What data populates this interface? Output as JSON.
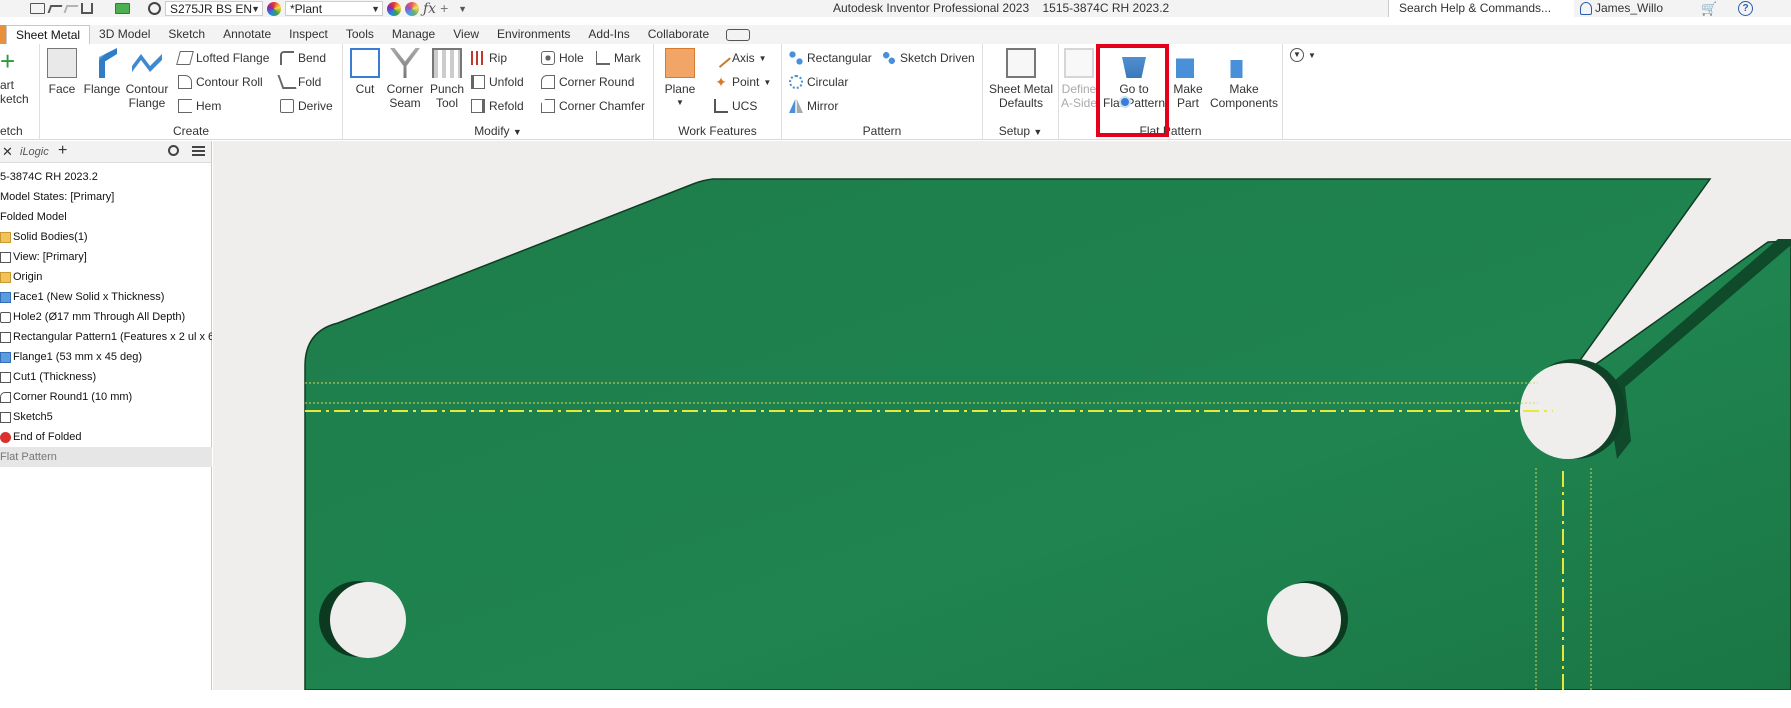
{
  "titlebar": {
    "material": "S275JR BS EN",
    "appearance": "*Plant",
    "app_name": "Autodesk Inventor Professional 2023",
    "doc_name": "1515-3874C RH 2023.2",
    "search_placeholder": "Search Help & Commands...",
    "user_name": "James_Willo"
  },
  "tabs": [
    {
      "label": "Sheet Metal",
      "active": true
    },
    {
      "label": "3D Model"
    },
    {
      "label": "Sketch"
    },
    {
      "label": "Annotate"
    },
    {
      "label": "Inspect"
    },
    {
      "label": "Tools"
    },
    {
      "label": "Manage"
    },
    {
      "label": "View"
    },
    {
      "label": "Environments"
    },
    {
      "label": "Add-Ins"
    },
    {
      "label": "Collaborate"
    }
  ],
  "ribbon": {
    "sketch": {
      "start": "art",
      "sketch": "ketch",
      "panel_title": "etch"
    },
    "create": {
      "panel_title": "Create",
      "face": "Face",
      "flange": "Flange",
      "contour_1": "Contour",
      "contour_2": "Flange",
      "lofted_flange": "Lofted Flange",
      "contour_roll": "Contour Roll",
      "hem": "Hem",
      "bend": "Bend",
      "fold": "Fold",
      "derive": "Derive"
    },
    "modify": {
      "panel_title": "Modify",
      "cut": "Cut",
      "corner_seam_1": "Corner",
      "corner_seam_2": "Seam",
      "punch_1": "Punch",
      "punch_2": "Tool",
      "rip": "Rip",
      "unfold": "Unfold",
      "refold": "Refold",
      "hole": "Hole",
      "corner_round": "Corner Round",
      "corner_chamfer": "Corner Chamfer",
      "mark": "Mark"
    },
    "work": {
      "panel_title": "Work Features",
      "plane": "Plane",
      "axis": "Axis",
      "point": "Point",
      "ucs": "UCS"
    },
    "pattern": {
      "panel_title": "Pattern",
      "rectangular": "Rectangular",
      "circular": "Circular",
      "mirror": "Mirror",
      "sketch_driven": "Sketch Driven"
    },
    "setup": {
      "panel_title": "Setup",
      "defaults_1": "Sheet Metal",
      "defaults_2": "Defaults"
    },
    "flat": {
      "panel_title": "Flat Pattern",
      "define_1": "Define",
      "define_2": "A-Side",
      "goto_1": "Go to",
      "goto_2": "Flat Pattern",
      "make_part_1": "Make",
      "make_part_2": "Part",
      "make_comp_1": "Make",
      "make_comp_2": "Components"
    }
  },
  "browser": {
    "header_label": "iLogic",
    "items": [
      {
        "label": "5-3874C RH 2023.2",
        "icon": "none"
      },
      {
        "label": "Model States: [Primary]",
        "icon": "none"
      },
      {
        "label": "Folded Model",
        "icon": "none"
      },
      {
        "label": "Solid Bodies(1)",
        "icon": "folder"
      },
      {
        "label": "View: [Primary]",
        "icon": "outline"
      },
      {
        "label": "Origin",
        "icon": "folder"
      },
      {
        "label": "Face1 (New Solid  x Thickness)",
        "icon": "blue"
      },
      {
        "label": "Hole2 (Ø17 mm Through All Depth)",
        "icon": "outline"
      },
      {
        "label": "Rectangular Pattern1 (Features x 2 ul x 6",
        "icon": "outline"
      },
      {
        "label": "Flange1 (53 mm x 45 deg)",
        "icon": "blue"
      },
      {
        "label": "Cut1 (Thickness)",
        "icon": "outline"
      },
      {
        "label": "Corner Round1 (10 mm)",
        "icon": "outline"
      },
      {
        "label": "Sketch5",
        "icon": "outline"
      },
      {
        "label": "End of Folded",
        "icon": "error"
      },
      {
        "label": "Flat Pattern",
        "icon": "none"
      }
    ]
  },
  "colors": {
    "part_green": "#1e7f4c",
    "highlight_red": "#e3001b",
    "centerline_yellow": "#e8e83a"
  }
}
